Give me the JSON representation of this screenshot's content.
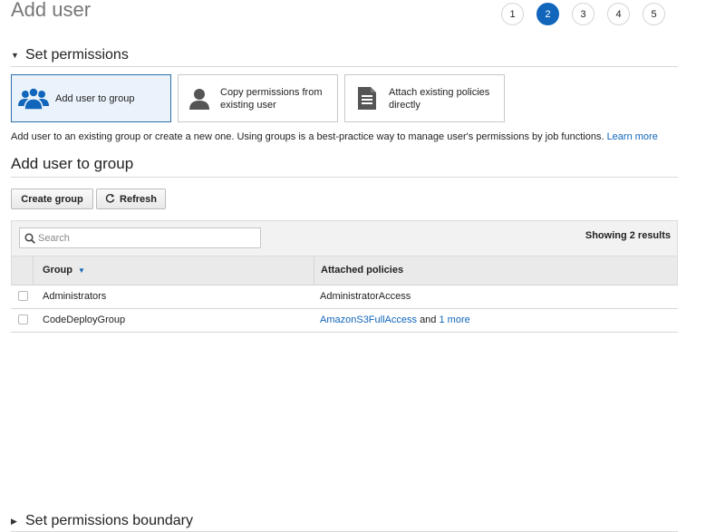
{
  "page": {
    "title": "Add user"
  },
  "wizard": {
    "steps": [
      "1",
      "2",
      "3",
      "4",
      "5"
    ],
    "active_step": "2"
  },
  "permissions_section": {
    "title": "Set permissions",
    "options": [
      {
        "label": "Add user to group",
        "icon": "users-group-icon",
        "selected": true
      },
      {
        "label": "Copy permissions from existing user",
        "icon": "user-icon",
        "selected": false
      },
      {
        "label": "Attach existing policies directly",
        "icon": "document-icon",
        "selected": false
      }
    ],
    "description": "Add user to an existing group or create a new one. Using groups is a best-practice way to manage user's permissions by job functions.",
    "learn_more": "Learn more"
  },
  "group_section": {
    "title": "Add user to group",
    "create_group_label": "Create group",
    "refresh_label": "Refresh",
    "search_placeholder": "Search",
    "results_text": "Showing 2 results",
    "columns": {
      "group": "Group",
      "policies": "Attached policies"
    },
    "rows": [
      {
        "group": "Administrators",
        "policy": "AdministratorAccess",
        "joiner": "",
        "more": ""
      },
      {
        "group": "CodeDeployGroup",
        "policy": "AmazonS3FullAccess",
        "joiner": "and",
        "more": "1 more"
      }
    ]
  },
  "boundary_section": {
    "title": "Set permissions boundary"
  },
  "colors": {
    "link": "#1166bb",
    "active_step": "#1166bb",
    "selected_border": "#2d6ea8",
    "icon": "#1166bb"
  }
}
